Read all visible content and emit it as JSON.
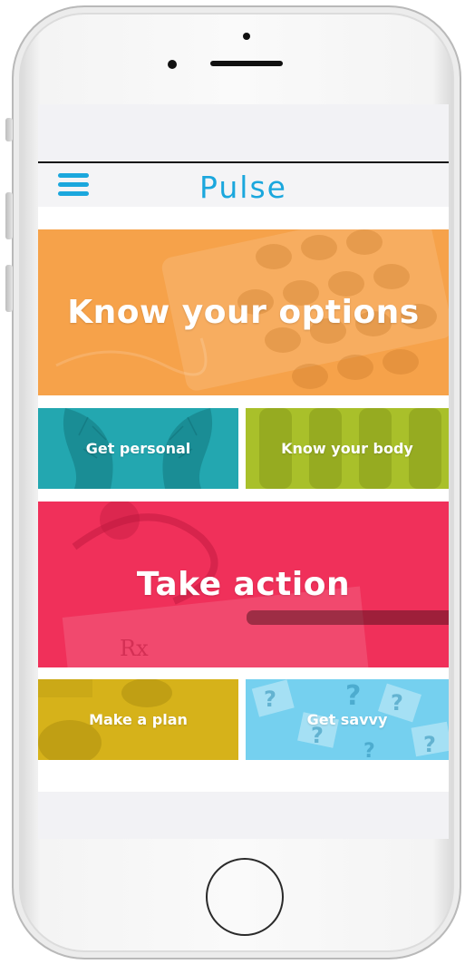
{
  "app": {
    "title": "Pulse",
    "brand_color": "#1ba7dd"
  },
  "nav": {
    "menu_icon": "hamburger-menu-icon"
  },
  "tiles": [
    {
      "id": "know-your-options",
      "label": "Know your options",
      "color": "#f6a24a",
      "imagery": "pills"
    },
    {
      "id": "get-personal",
      "label": "Get personal",
      "color": "#23a7b0",
      "imagery": "faces-trees"
    },
    {
      "id": "know-your-body",
      "label": "Know your body",
      "color": "#a9c02a",
      "imagery": "legs"
    },
    {
      "id": "take-action",
      "label": "Take action",
      "color": "#f0305a",
      "imagery": "stethoscope-pen"
    },
    {
      "id": "make-a-plan",
      "label": "Make a plan",
      "color": "#d6b21a",
      "imagery": "hands"
    },
    {
      "id": "get-savvy",
      "label": "Get savvy",
      "color": "#75d0ef",
      "imagery": "question-marks"
    }
  ],
  "device": {
    "frame_color": "#f4f4f4",
    "home_button_icon": "home-button-icon"
  }
}
